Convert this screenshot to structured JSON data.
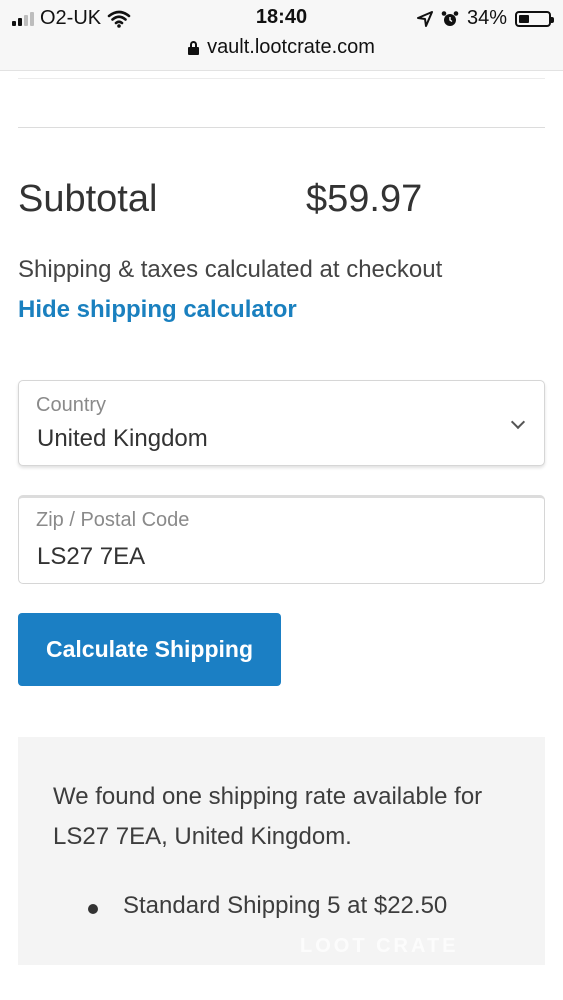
{
  "status_bar": {
    "carrier": "O2-UK",
    "time": "18:40",
    "battery": "34%",
    "battery_level": 0.34,
    "icons": [
      "signal-bars-icon",
      "wifi-icon",
      "location-arrow-icon",
      "alarm-clock-icon",
      "battery-icon"
    ]
  },
  "browser": {
    "url": "vault.lootcrate.com"
  },
  "cart": {
    "subtotal_label": "Subtotal",
    "subtotal_value": "$59.97",
    "shipping_note": "Shipping & taxes calculated at checkout",
    "hide_calculator_link": "Hide shipping calculator"
  },
  "calculator": {
    "country_label": "Country",
    "country_value": "United Kingdom",
    "zip_label": "Zip / Postal Code",
    "zip_value": "LS27 7EA",
    "button_label": "Calculate Shipping"
  },
  "rates": {
    "message": "We found one shipping rate available for LS27 7EA, United Kingdom.",
    "items": [
      "Standard Shipping 5 at $22.50"
    ]
  },
  "watermark": "LOOT CRATE"
}
